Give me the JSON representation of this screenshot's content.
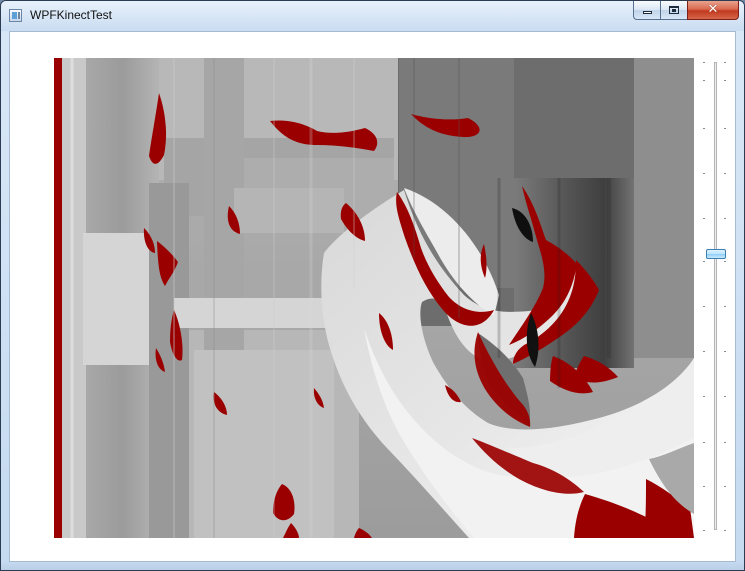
{
  "window": {
    "title": "WPFKinectTest",
    "icon": "application-window-icon"
  },
  "caption_buttons": {
    "minimize_icon": "minimize-icon",
    "maximize_icon": "maximize-icon",
    "close_icon": "close-icon",
    "close_glyph": "✕"
  },
  "depth_view": {
    "image": "kinect-depth-map",
    "invalid_depth_color": "#9b0000",
    "near_depth_color": "#f4f4f4",
    "far_depth_color": "#333333"
  },
  "slider": {
    "orientation": "vertical",
    "value_fraction": 0.59,
    "thumb_color": "#b8e3ff"
  }
}
